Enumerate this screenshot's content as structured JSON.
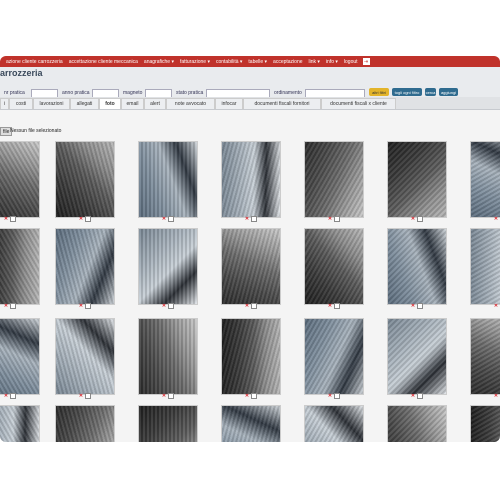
{
  "nav": {
    "items": [
      "azione cliente carrozzeria",
      "accettazione cliente meccanica",
      "anagrafiche ▾",
      "fatturazione ▾",
      "contabilità ▾",
      "tabelle ▾",
      "acceptazione",
      "link ▾",
      "info ▾",
      "logout"
    ],
    "exit_glyph": "⇥"
  },
  "app": {
    "title": "arrozzeria"
  },
  "filters": {
    "nr_pratica_label": "nr pratica",
    "anno_pratica_label": "anno pratica",
    "targa_label": "magneto",
    "stato_pratica_label": "stato pratica",
    "ordinamento_label": "ordinamento",
    "buttons": [
      "altri filtri",
      "togli ogni filtro",
      "cerca",
      "aggiungi"
    ]
  },
  "tabs": [
    "i",
    "costi",
    "lavorazioni",
    "allegati",
    "foto",
    "email",
    "alert",
    "note avvocato",
    "infocar",
    "documenti fiscali fornitori",
    "documenti fiscali x cliente"
  ],
  "active_tab": "foto",
  "upload": {
    "button": "file",
    "status": "Nessun file selezionato"
  },
  "gallery": {
    "delete_glyph": "✕",
    "colors": {
      "delete": "#d8232a",
      "nav": "#c0322b"
    }
  }
}
